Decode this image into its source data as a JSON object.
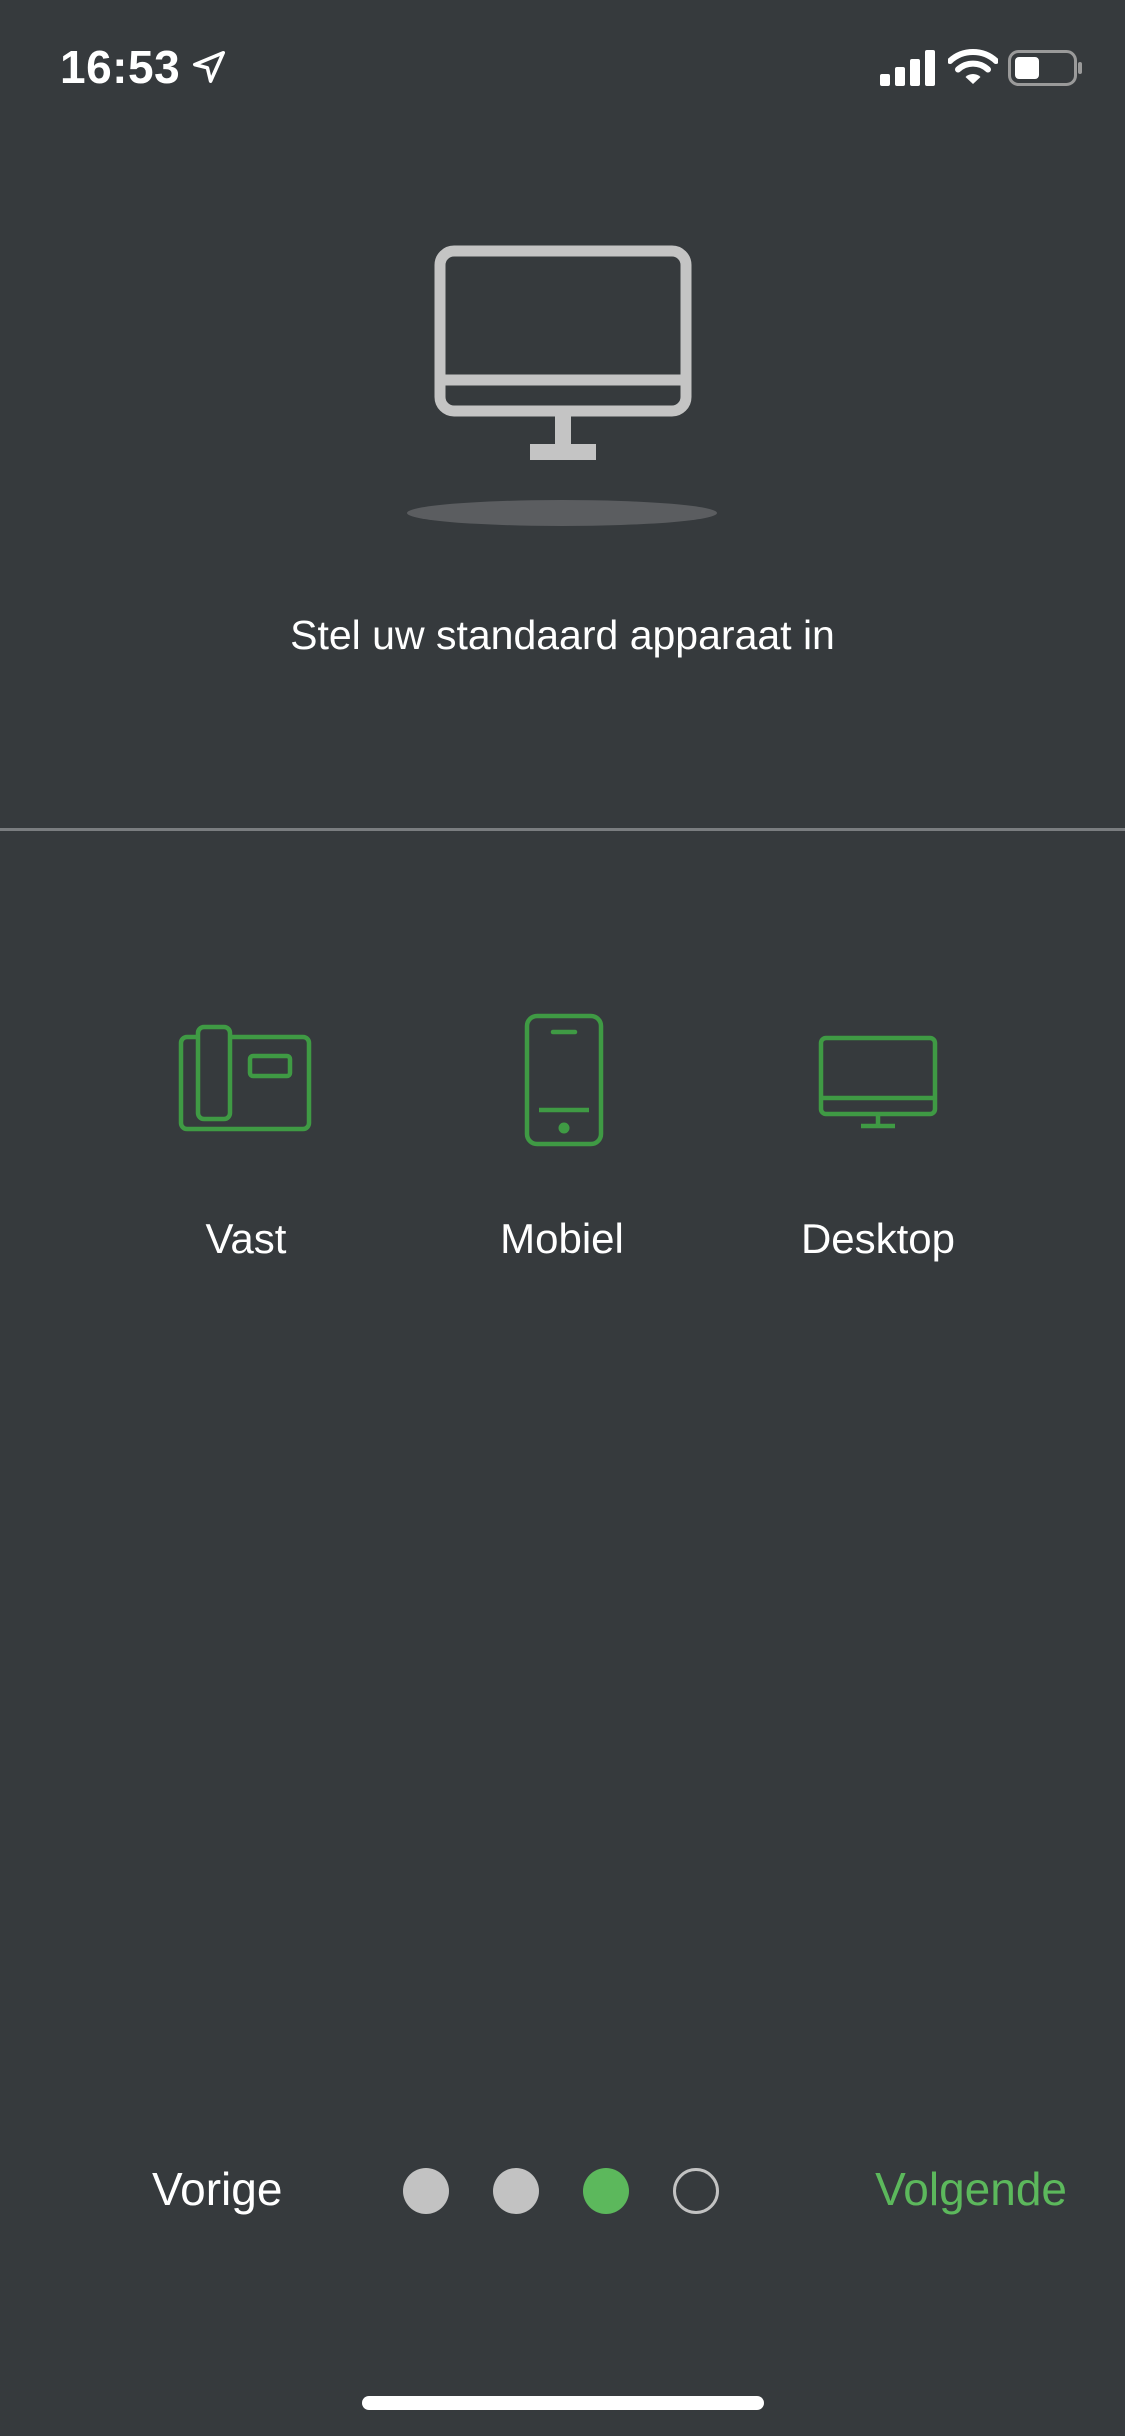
{
  "status_bar": {
    "time": "16:53",
    "icons": [
      "location-arrow-icon",
      "cellular-signal-icon",
      "wifi-icon",
      "battery-icon"
    ]
  },
  "hero": {
    "icon": "desktop-monitor-icon",
    "title": "Stel uw standaard apparaat in"
  },
  "devices": [
    {
      "label": "Vast",
      "icon": "desk-phone-icon"
    },
    {
      "label": "Mobiel",
      "icon": "mobile-phone-icon"
    },
    {
      "label": "Desktop",
      "icon": "desktop-icon"
    }
  ],
  "footer": {
    "prev_label": "Vorige",
    "next_label": "Volgende",
    "pages_total": 4,
    "current_page": 3
  },
  "colors": {
    "background": "#363a3d",
    "accent": "#5cb85c",
    "icon_green": "#3f9a44",
    "hero_icon": "#c4c4c4",
    "divider": "#7a7d80",
    "text": "#ffffff"
  }
}
